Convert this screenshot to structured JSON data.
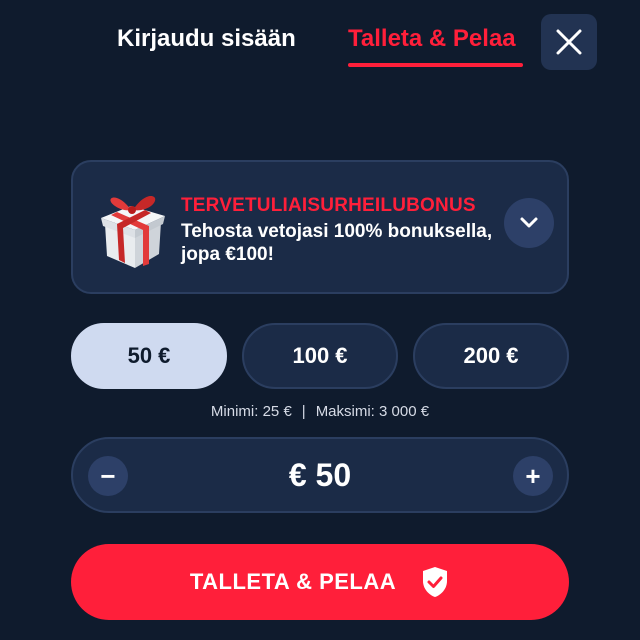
{
  "header": {
    "tabs": [
      {
        "label": "Kirjaudu sisään",
        "active": false
      },
      {
        "label": "Talleta & Pelaa",
        "active": true
      }
    ],
    "close_icon": "close-icon"
  },
  "bonus": {
    "icon": "gift-icon",
    "title": "TERVETULIAISURHEILUBONUS",
    "description": "Tehosta vetojasi 100% bonuksella, jopa €100!",
    "expand_icon": "chevron-down-icon"
  },
  "presets": [
    {
      "label": "50 €",
      "selected": true
    },
    {
      "label": "100 €",
      "selected": false
    },
    {
      "label": "200 €",
      "selected": false
    }
  ],
  "limits": {
    "min": "Minimi: 25 €",
    "separator": "|",
    "max": "Maksimi: 3 000 €"
  },
  "stepper": {
    "minus_label": "−",
    "value": "€ 50",
    "plus_label": "+"
  },
  "cta": {
    "label": "TALLETA & PELAA",
    "icon": "shield-check-icon"
  },
  "colors": {
    "background": "#0f1b2d",
    "accent": "#ff1f3a",
    "card": "#1b2b47",
    "selected_preset": "#cfdaf0"
  }
}
